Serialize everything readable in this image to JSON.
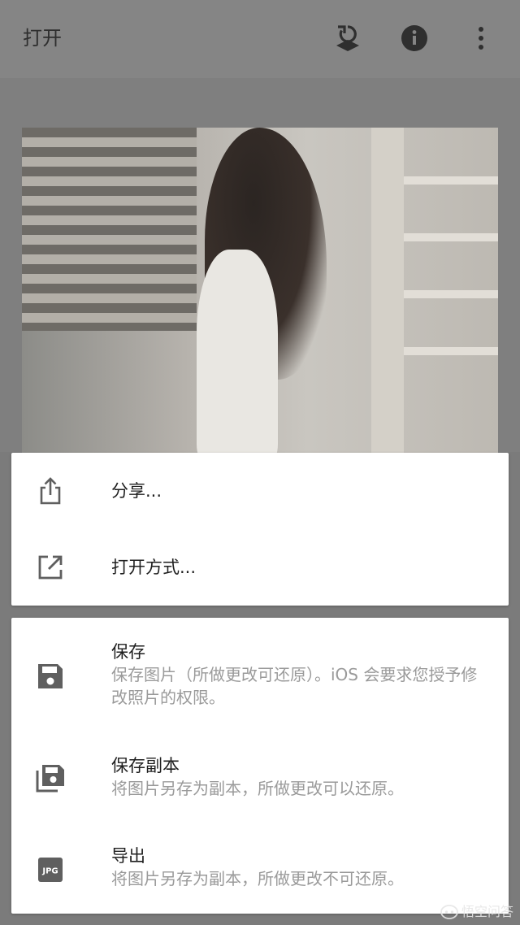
{
  "appbar": {
    "title": "打开",
    "icons": {
      "swap_layers": "swap-layers-icon",
      "info": "info-icon",
      "more": "more-vertical-icon"
    }
  },
  "photo": {
    "description_kind": "image"
  },
  "sheet": {
    "share": {
      "label": "分享...",
      "icon": "share-icon"
    },
    "open_with": {
      "label": "打开方式...",
      "icon": "open-external-icon"
    },
    "save": {
      "label": "保存",
      "desc": "保存图片（所做更改可还原）。iOS 会要求您授予修改照片的权限。",
      "icon": "save-icon"
    },
    "save_copy": {
      "label": "保存副本",
      "desc": "将图片另存为副本，所做更改可以还原。",
      "icon": "save-copy-icon"
    },
    "export": {
      "label": "导出",
      "desc": "将图片另存为副本，所做更改不可还原。",
      "icon": "jpg-icon",
      "icon_text": "JPG"
    }
  },
  "watermark": {
    "text": "悟空问答"
  },
  "colors": {
    "scrim": "#7b7b7b",
    "card": "#ffffff",
    "label": "#1f1f1f",
    "desc": "#9a9a9a",
    "icon": "#5f5f5f"
  }
}
